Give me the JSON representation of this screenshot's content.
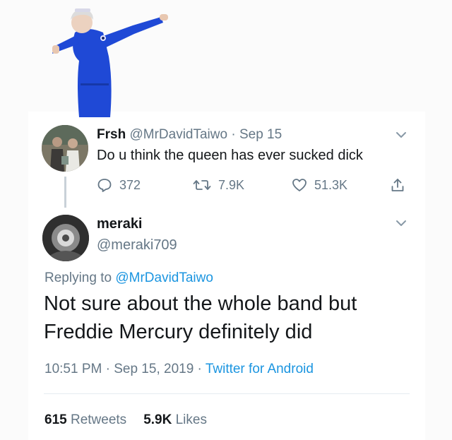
{
  "tweet1": {
    "name": "Frsh",
    "handle": "@MrDavidTaiwo",
    "separator": "·",
    "date": "Sep 15",
    "text": "Do u think the queen has ever sucked dick",
    "reply_count": "372",
    "retweet_count": "7.9K",
    "like_count": "51.3K"
  },
  "tweet2": {
    "name": "meraki",
    "handle": "@meraki709",
    "replying_prefix": "Replying to",
    "replying_handle": "@MrDavidTaiwo",
    "text_line1": "Not sure about the whole band but",
    "text_line2": "Freddie Mercury definitely did",
    "time": "10:51 PM",
    "sep1": "·",
    "date": "Sep 15, 2019",
    "sep2": "·",
    "client": "Twitter for Android",
    "retweets_count": "615",
    "retweets_label": "Retweets",
    "likes_count": "5.9K",
    "likes_label": "Likes"
  },
  "colors": {
    "link": "#1b95e0",
    "muted": "#657786",
    "text": "#14171a",
    "sticker_dress": "#1f49d6"
  },
  "icons": [
    "reply-icon",
    "retweet-icon",
    "heart-icon",
    "share-icon",
    "chevron-down-icon"
  ]
}
